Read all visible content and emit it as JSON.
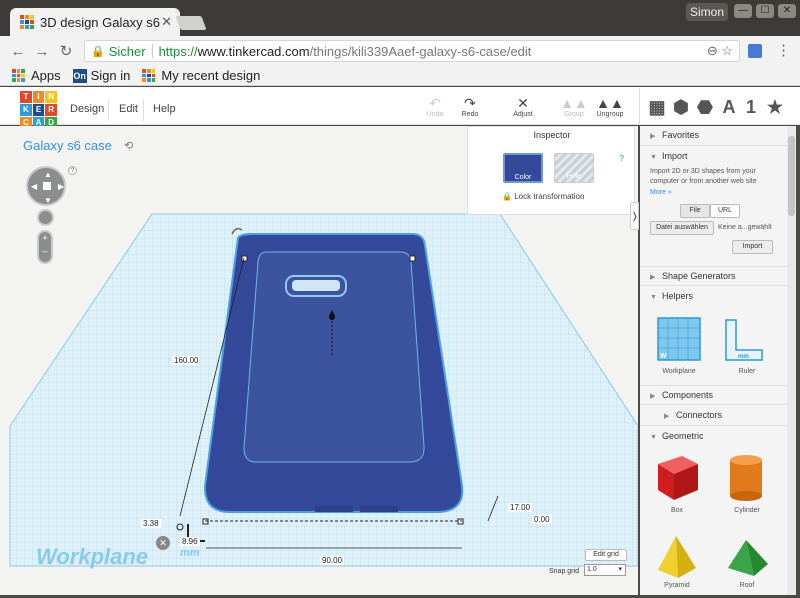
{
  "browser": {
    "tab_title": "3D design Galaxy s6",
    "tab_close": "✕",
    "profile": "Simon",
    "window_buttons": [
      "—",
      "☐",
      "✕"
    ],
    "nav": {
      "back": "←",
      "forward": "→",
      "reload": "↻"
    },
    "omnibox": {
      "secure_label": "Sicher",
      "url_proto": "https://",
      "url_host": "www.tinkercad.com",
      "url_path": "/things/kili339Aaef-galaxy-s6-case/edit",
      "icons": "⊖  ☆"
    },
    "bookmarks": [
      {
        "label": "Apps"
      },
      {
        "label": "Sign in",
        "badge": "On"
      },
      {
        "label": "My recent design"
      }
    ]
  },
  "app": {
    "logo_letters": [
      "TIN",
      "KER",
      "CAD"
    ],
    "logo_cells": [
      "T",
      "I",
      "N",
      "K",
      "E",
      "R",
      "C",
      "A",
      "D"
    ],
    "logo_colors": [
      "#e0492c",
      "#f08c1f",
      "#f0c51f",
      "#2e9ad6",
      "#1d4e89",
      "#e0492c",
      "#f08c1f",
      "#2e9ad6",
      "#3aa548"
    ],
    "menu": [
      "Design",
      "Edit",
      "Help"
    ],
    "tools": [
      {
        "name": "undo",
        "label": "Undo",
        "glyph": "↶",
        "enabled": false
      },
      {
        "name": "redo",
        "label": "Redo",
        "glyph": "↷",
        "enabled": true
      },
      {
        "name": "adjust",
        "label": "Adjust",
        "glyph": "✕",
        "enabled": true
      },
      {
        "name": "group",
        "label": "Group",
        "glyph": "▲▲",
        "enabled": false
      },
      {
        "name": "ungroup",
        "label": "Ungroup",
        "glyph": "▲▲",
        "enabled": true
      }
    ],
    "view_icons": [
      "▦",
      "⬢",
      "⬣",
      "A",
      "1",
      "★"
    ]
  },
  "canvas": {
    "design_title": "Galaxy s6 case",
    "workplane_label": "Workplane",
    "workplane_unit": "mm",
    "nav_arrows": {
      "up": "▲",
      "down": "▼",
      "left": "◀",
      "right": "▶"
    },
    "help": "?",
    "zoom": {
      "plus": "+",
      "minus": "–"
    },
    "clear": "✕",
    "edit_grid": "Edit grid",
    "snap_grid_label": "Snap grid",
    "snap_grid_value": "1.0",
    "dimensions": {
      "length": "160.00",
      "width": "90.00",
      "height": "17.00",
      "elevation": "0.00",
      "offset_x": "3.38",
      "offset_y": "8.96"
    }
  },
  "inspector": {
    "title": "Inspector",
    "help": "?",
    "color_label": "Color",
    "hole_label": "Hole",
    "lock_label": "Lock transformation",
    "color": "#34499a"
  },
  "sidebar": {
    "favorites": "Favorites",
    "import": {
      "title": "Import",
      "description": "Import 2D or 3D shapes from your computer or from another web site",
      "more": "More »",
      "file_tab": "File",
      "url_tab": "URL",
      "choose_file": "Datei auswählen",
      "no_file": "Keine a...gewählt",
      "import_button": "Import"
    },
    "shape_generators": "Shape Generators",
    "helpers": {
      "title": "Helpers",
      "items": [
        "Workplane",
        "Ruler"
      ]
    },
    "components": "Components",
    "connectors": "Connectors",
    "geometric": {
      "title": "Geometric",
      "items": [
        "Box",
        "Cylinder",
        "Pyramid",
        "Roof"
      ]
    }
  },
  "colors": {
    "shape_blue": "#34499a",
    "shape_edge": "#4aa0e6",
    "grid": "#a8d5ea",
    "link_blue": "#3b8fd6"
  }
}
